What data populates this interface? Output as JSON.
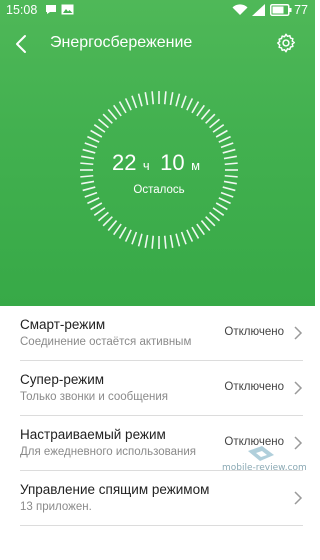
{
  "status_bar": {
    "time": "15:08",
    "battery": "77",
    "icons": [
      "chat-bubble-icon",
      "image-icon",
      "wifi-icon",
      "signal-icon",
      "battery-icon"
    ]
  },
  "app_bar": {
    "title": "Энергосбережение",
    "back_icon": "back-arrow-icon",
    "settings_icon": "gear-icon"
  },
  "gauge": {
    "hours": "22",
    "hours_unit": "ч",
    "minutes": "10",
    "minutes_unit": "м",
    "caption": "Осталось"
  },
  "modes": [
    {
      "label": "Смарт-режим",
      "desc": "Соединение остаётся активным",
      "status": "Отключено"
    },
    {
      "label": "Супер-режим",
      "desc": "Только звонки и сообщения",
      "status": "Отключено"
    },
    {
      "label": "Настраиваемый режим",
      "desc": "Для ежедневного использования",
      "status": "Отключено"
    },
    {
      "label": "Управление спящим режимом",
      "desc": "13 приложен.",
      "status": ""
    }
  ],
  "watermark": "mobile-review.com",
  "colors": {
    "accent_green": "#43b150",
    "text_primary": "#222222",
    "text_secondary": "#8a8a8a"
  }
}
